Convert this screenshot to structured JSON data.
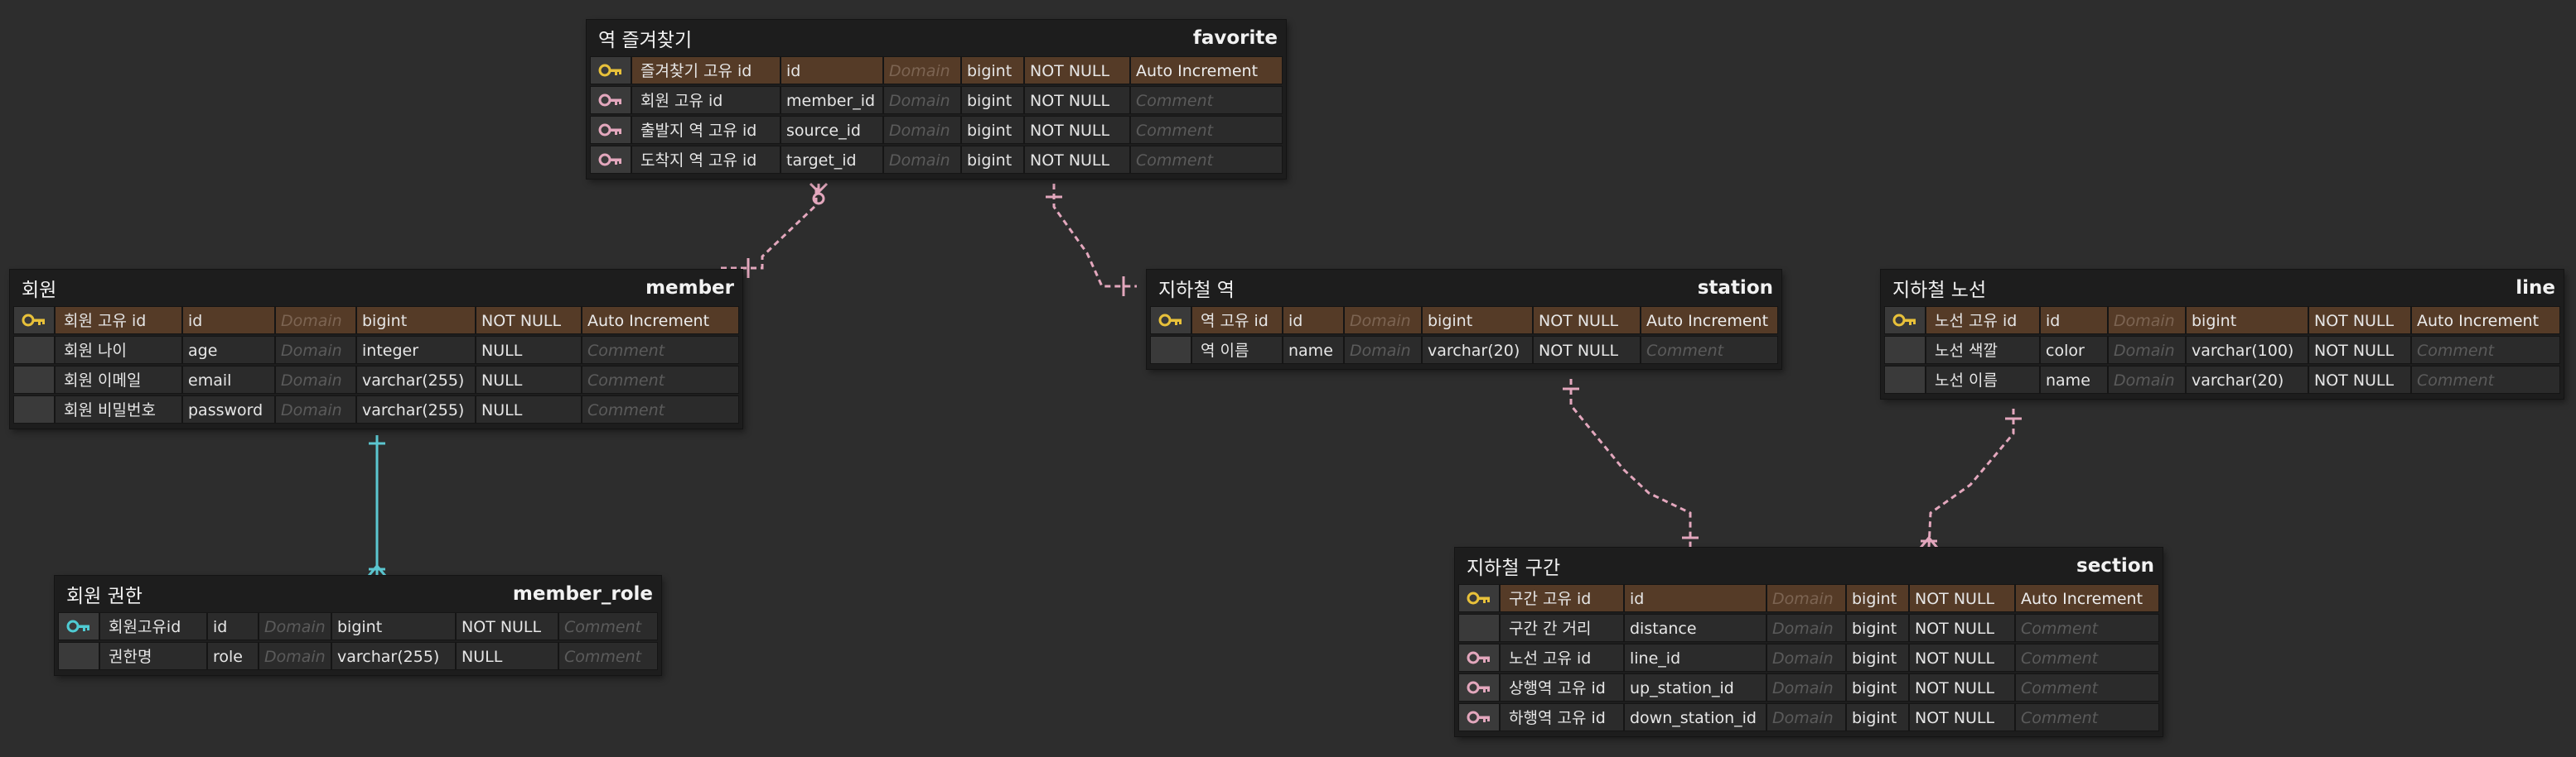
{
  "colors": {
    "background": "#2d2d2d",
    "relationship_line": "#e3a7bd",
    "identifying_line": "#5bc6d0",
    "primary_key_icon": "#e8c13a",
    "foreign_key_icon": "#e3a7bd",
    "pk_fk_icon": "#4fcbd3",
    "pk_row_fill": "#553b27"
  },
  "entities": [
    {
      "logical": "역 즐겨찾기",
      "physical": "favorite",
      "attributes": [
        {
          "icon": "primary-key-icon",
          "logical": "즐겨찾기 고유 id",
          "physical": "id",
          "domain": "Domain",
          "type": "bigint",
          "nullable": "NOT NULL",
          "comment": "Auto Increment"
        },
        {
          "icon": "foreign-key-icon",
          "logical": "회원 고유 id",
          "physical": "member_id",
          "domain": "Domain",
          "type": "bigint",
          "nullable": "NOT NULL",
          "comment": "Comment"
        },
        {
          "icon": "foreign-key-icon",
          "logical": "출발지 역 고유 id",
          "physical": "source_id",
          "domain": "Domain",
          "type": "bigint",
          "nullable": "NOT NULL",
          "comment": "Comment"
        },
        {
          "icon": "foreign-key-icon",
          "logical": "도착지 역 고유 id",
          "physical": "target_id",
          "domain": "Domain",
          "type": "bigint",
          "nullable": "NOT NULL",
          "comment": "Comment"
        }
      ]
    },
    {
      "logical": "회원",
      "physical": "member",
      "attributes": [
        {
          "icon": "primary-key-icon",
          "logical": "회원 고유 id",
          "physical": "id",
          "domain": "Domain",
          "type": "bigint",
          "nullable": "NOT NULL",
          "comment": "Auto Increment"
        },
        {
          "icon": "",
          "logical": "회원 나이",
          "physical": "age",
          "domain": "Domain",
          "type": "integer",
          "nullable": "NULL",
          "comment": "Comment"
        },
        {
          "icon": "",
          "logical": "회원 이메일",
          "physical": "email",
          "domain": "Domain",
          "type": "varchar(255)",
          "nullable": "NULL",
          "comment": "Comment"
        },
        {
          "icon": "",
          "logical": "회원 비밀번호",
          "physical": "password",
          "domain": "Domain",
          "type": "varchar(255)",
          "nullable": "NULL",
          "comment": "Comment"
        }
      ]
    },
    {
      "logical": "회원 권한",
      "physical": "member_role",
      "attributes": [
        {
          "icon": "pk-fk-icon",
          "logical": "회원고유id",
          "physical": "id",
          "domain": "Domain",
          "type": "bigint",
          "nullable": "NOT NULL",
          "comment": "Comment"
        },
        {
          "icon": "",
          "logical": "권한명",
          "physical": "role",
          "domain": "Domain",
          "type": "varchar(255)",
          "nullable": "NULL",
          "comment": "Comment"
        }
      ]
    },
    {
      "logical": "지하철 역",
      "physical": "station",
      "attributes": [
        {
          "icon": "primary-key-icon",
          "logical": "역 고유 id",
          "physical": "id",
          "domain": "Domain",
          "type": "bigint",
          "nullable": "NOT NULL",
          "comment": "Auto Increment"
        },
        {
          "icon": "",
          "logical": "역 이름",
          "physical": "name",
          "domain": "Domain",
          "type": "varchar(20)",
          "nullable": "NOT NULL",
          "comment": "Comment"
        }
      ]
    },
    {
      "logical": "지하철 노선",
      "physical": "line",
      "attributes": [
        {
          "icon": "primary-key-icon",
          "logical": "노선 고유 id",
          "physical": "id",
          "domain": "Domain",
          "type": "bigint",
          "nullable": "NOT NULL",
          "comment": "Auto Increment"
        },
        {
          "icon": "",
          "logical": "노선 색깔",
          "physical": "color",
          "domain": "Domain",
          "type": "varchar(100)",
          "nullable": "NOT NULL",
          "comment": "Comment"
        },
        {
          "icon": "",
          "logical": "노선 이름",
          "physical": "name",
          "domain": "Domain",
          "type": "varchar(20)",
          "nullable": "NOT NULL",
          "comment": "Comment"
        }
      ]
    },
    {
      "logical": "지하철 구간",
      "physical": "section",
      "attributes": [
        {
          "icon": "primary-key-icon",
          "logical": "구간 고유 id",
          "physical": "id",
          "domain": "Domain",
          "type": "bigint",
          "nullable": "NOT NULL",
          "comment": "Auto Increment"
        },
        {
          "icon": "",
          "logical": "구간 간 거리",
          "physical": "distance",
          "domain": "Domain",
          "type": "bigint",
          "nullable": "NOT NULL",
          "comment": "Comment"
        },
        {
          "icon": "foreign-key-icon",
          "logical": "노선 고유 id",
          "physical": "line_id",
          "domain": "Domain",
          "type": "bigint",
          "nullable": "NOT NULL",
          "comment": "Comment"
        },
        {
          "icon": "foreign-key-icon",
          "logical": "상행역 고유 id",
          "physical": "up_station_id",
          "domain": "Domain",
          "type": "bigint",
          "nullable": "NOT NULL",
          "comment": "Comment"
        },
        {
          "icon": "foreign-key-icon",
          "logical": "하행역 고유 id",
          "physical": "down_station_id",
          "domain": "Domain",
          "type": "bigint",
          "nullable": "NOT NULL",
          "comment": "Comment"
        }
      ]
    }
  ],
  "relationships": [
    {
      "parent": "member",
      "child": "favorite",
      "style": "dashed",
      "child_cardinality": "zero-or-many"
    },
    {
      "parent": "station",
      "child": "favorite",
      "style": "dashed",
      "child_cardinality": "one"
    },
    {
      "parent": "member",
      "child": "member_role",
      "style": "solid",
      "child_cardinality": "many"
    },
    {
      "parent": "station",
      "child": "section",
      "style": "dashed",
      "child_cardinality": "one"
    },
    {
      "parent": "line",
      "child": "section",
      "style": "dashed",
      "child_cardinality": "many"
    }
  ]
}
